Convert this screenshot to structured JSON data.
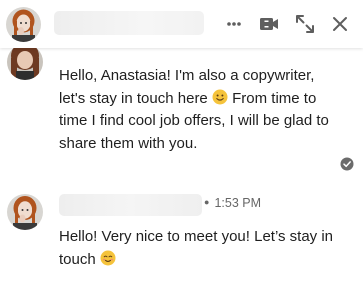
{
  "header": {
    "contact_name": "",
    "more_icon": "more-horizontal-icon",
    "video_icon": "video-camera-icon",
    "expand_icon": "expand-diagonal-icon",
    "close_icon": "close-icon"
  },
  "messages": [
    {
      "sender": "",
      "time": "",
      "text_before": "Hello, Anastasia! I'm also a copywriter, let's stay in touch here ",
      "emoji": "slightly-smiling-face",
      "text_after": " From time to time I find cool job offers, I will be glad to share them with you.",
      "read_receipt": "check-circle-icon"
    },
    {
      "sender": "",
      "time": "1:53 PM",
      "text_before": "Hello! Very nice to meet you! Let’s stay in touch ",
      "emoji": "relieved-smiling-face",
      "text_after": ""
    }
  ],
  "colors": {
    "text": "#1f1f1f",
    "muted": "#666666",
    "icon": "#5e5e5e",
    "emoji_yellow": "#f5c33b"
  }
}
